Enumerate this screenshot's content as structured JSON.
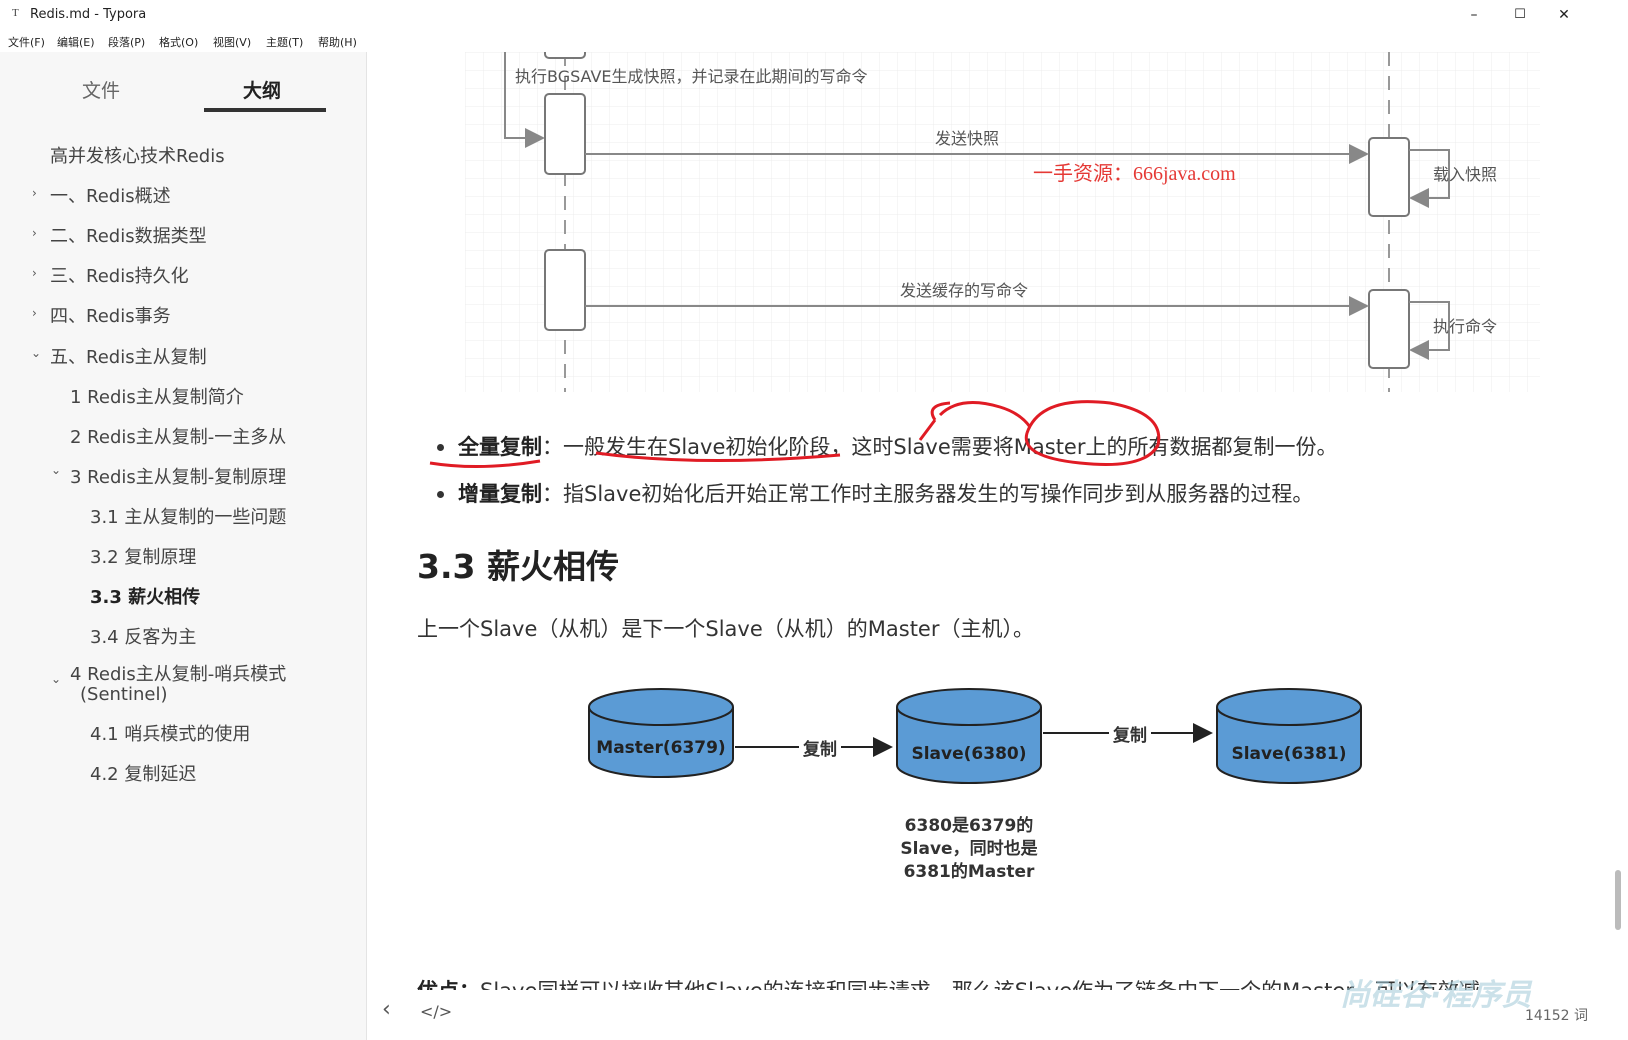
{
  "window": {
    "title": "Redis.md - Typora",
    "app_icon": "T",
    "controls": {
      "minimize": "–",
      "maximize": "☐",
      "close": "✕"
    }
  },
  "menu": [
    "文件(F)",
    "编辑(E)",
    "段落(P)",
    "格式(O)",
    "视图(V)",
    "主题(T)",
    "帮助(H)"
  ],
  "sidebar": {
    "tabs": {
      "files": "文件",
      "outline": "大纲"
    },
    "outline": [
      {
        "label": "高并发核心技术Redis"
      },
      {
        "label": "一、Redis概述"
      },
      {
        "label": "二、Redis数据类型"
      },
      {
        "label": "三、Redis持久化"
      },
      {
        "label": "四、Redis事务"
      },
      {
        "label": "五、Redis主从复制"
      },
      {
        "label": "1 Redis主从复制简介"
      },
      {
        "label": "2 Redis主从复制-一主多从"
      },
      {
        "label": "3 Redis主从复制-复制原理"
      },
      {
        "label": "3.1 主从复制的一些问题"
      },
      {
        "label": "3.2 复制原理"
      },
      {
        "label": "3.3 薪火相传"
      },
      {
        "label": "3.4 反客为主"
      },
      {
        "label": "4 Redis主从复制-哨兵模式"
      },
      {
        "label": "(Sentinel)"
      },
      {
        "label": "4.1 哨兵模式的使用"
      },
      {
        "label": "4.2 复制延迟"
      }
    ]
  },
  "sequence_diagram": {
    "note_bgsave": "执行BGSAVE生成快照，并记录在此期间的写命令",
    "send_snapshot": "发送快照",
    "load_snapshot": "载入快照",
    "send_buffered": "发送缓存的写命令",
    "exec_command": "执行命令",
    "promo_text": "一手资源：666java.com"
  },
  "content": {
    "bullet1_term": "全量复制",
    "bullet1_text": "：一般发生在Slave初始化阶段，这时Slave需要将Master上的所有数据都复制一份。",
    "bullet2_term": "增量复制",
    "bullet2_text": "：指Slave初始化后开始正常工作时主服务器发生的写操作同步到从服务器的过程。",
    "heading": "3.3 薪火相传",
    "paragraph": "上一个Slave（从机）是下一个Slave（从机）的Master（主机）。",
    "cut_paragraph_term": "优点：",
    "cut_paragraph_text": "Slave同样可以接收其他Slave的连接和同步请求，那么该Slave作为了链条中下一个的Master，可以有效减"
  },
  "chain_diagram": {
    "nodes": [
      "Master(6379)",
      "Slave(6380)",
      "Slave(6381)"
    ],
    "edge_labels": [
      "复制",
      "复制"
    ],
    "caption": [
      "6380是6379的",
      "Slave，同时也是",
      "6381的Master"
    ],
    "fill_color": "#5b9bd5"
  },
  "footer": {
    "back": "‹",
    "source_toggle": "</>",
    "word_count": "14152 词",
    "watermark": "尚硅谷·程序员"
  }
}
